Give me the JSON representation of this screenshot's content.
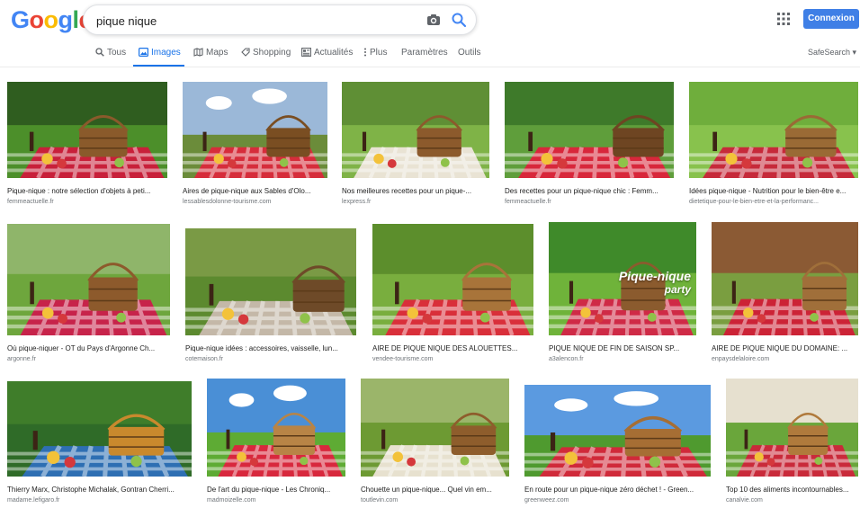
{
  "logo": {
    "letters": [
      "G",
      "o",
      "o",
      "g",
      "l",
      "e"
    ],
    "colors": [
      "#4285f4",
      "#ea4335",
      "#fbbc05",
      "#4285f4",
      "#34a853",
      "#ea4335"
    ]
  },
  "search": {
    "query": "pique nique"
  },
  "header": {
    "signin_label": "Connexion"
  },
  "tabs": [
    {
      "label": "Tous",
      "icon": "search-icon"
    },
    {
      "label": "Images",
      "icon": "image-icon"
    },
    {
      "label": "Maps",
      "icon": "map-icon"
    },
    {
      "label": "Shopping",
      "icon": "tag-icon"
    },
    {
      "label": "Actualités",
      "icon": "newspaper-icon"
    },
    {
      "label": "Plus",
      "icon": "more-vert-icon"
    },
    {
      "label": "Paramètres"
    },
    {
      "label": "Outils"
    }
  ],
  "safesearch": "SafeSearch ▾",
  "results": [
    {
      "title": "Pique-nique : notre sélection d'objets à peti...",
      "source": "femmeactuelle.fr"
    },
    {
      "title": "Aires de pique-nique aux Sables d'Olo...",
      "source": "lessablesdolonne-tourisme.com"
    },
    {
      "title": "Nos meilleures recettes pour un pique-...",
      "source": "lexpress.fr"
    },
    {
      "title": "Des recettes pour un pique-nique chic : Femm...",
      "source": "femmeactuelle.fr"
    },
    {
      "title": "Idées pique-nique - Nutrition pour le bien-être e...",
      "source": "dietetique-pour-le-bien-etre-et-la-performanc..."
    },
    {
      "title": "Où pique-niquer - OT du Pays d'Argonne Ch...",
      "source": "argonne.fr"
    },
    {
      "title": "Pique-nique idées : accessoires, vaisselle, lun...",
      "source": "cotemaison.fr"
    },
    {
      "title": "AIRE DE PIQUE NIQUE DES ALOUETTES...",
      "source": "vendee-tourisme.com"
    },
    {
      "title": "PIQUE NIQUE DE FIN DE SAISON SP...",
      "source": "a3alencon.fr",
      "overlay": [
        "Pique-nique",
        "party"
      ]
    },
    {
      "title": "AIRE DE PIQUE NIQUE DU DOMAINE: ...",
      "source": "enpaysdelaloire.com"
    },
    {
      "title": "Thierry Marx, Christophe Michalak, Gontran Cherri...",
      "source": "madame.lefigaro.fr"
    },
    {
      "title": "De l'art du pique-nique - Les Chroniq...",
      "source": "madmoizelle.com"
    },
    {
      "title": "Chouette un pique-nique... Quel vin em...",
      "source": "toutlevin.com"
    },
    {
      "title": "En route pour un pique-nique zéro déchet ! - Green...",
      "source": "greenweez.com"
    },
    {
      "title": "Top 10 des aliments incontournables...",
      "source": "canalvie.com"
    }
  ]
}
